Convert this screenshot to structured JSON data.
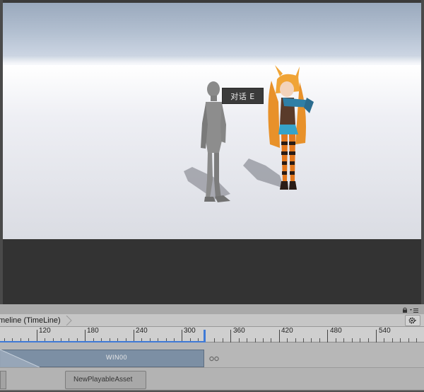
{
  "viewport": {
    "prompt_text": "对话 E"
  },
  "timeline": {
    "window_title": "meline (TimeLine)",
    "ruler_ticks": [
      "120",
      "180",
      "240",
      "300",
      "360",
      "420",
      "480",
      "540"
    ],
    "track1_clip_label": "WIN00",
    "track2_clip_label": "NewPlayableAsset"
  },
  "colors": {
    "sky": "#a9b6c8",
    "ground": "#eceef3",
    "playhead": "#3f7ad6",
    "clip_blue": "#7c8fa4",
    "clip_gray": "#a8a8a8"
  },
  "icons": [
    "lock-icon",
    "menu-icon",
    "gear-icon",
    "chevron-right-icon",
    "loop-icon"
  ]
}
